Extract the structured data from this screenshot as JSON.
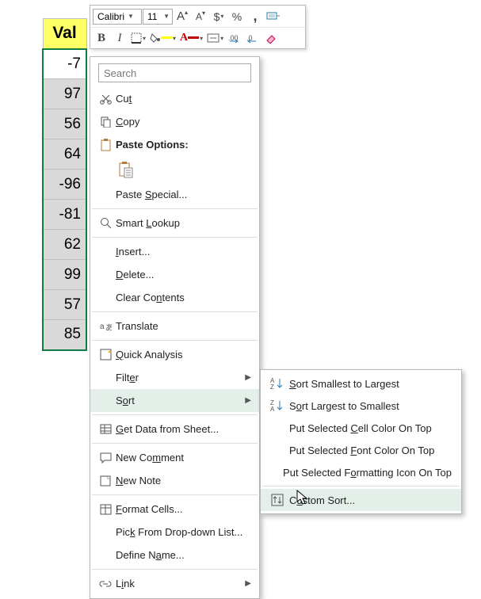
{
  "toolbar": {
    "font": "Calibri",
    "size": "11",
    "increaseFont": "A",
    "decreaseFont": "A",
    "currency": "$",
    "percent": "%",
    "comma": ",",
    "bold": "B",
    "italic": "I"
  },
  "sheet": {
    "header": "Val",
    "values": [
      "-7",
      "97",
      "56",
      "64",
      "-96",
      "-81",
      "62",
      "99",
      "57",
      "85"
    ]
  },
  "search": {
    "placeholder": "Search"
  },
  "ctx": {
    "cut": "Cut",
    "copy": "Copy",
    "pasteOptions": "Paste Options:",
    "pasteSpecial": "Paste Special...",
    "smartLookup": "Smart Lookup",
    "insert": "Insert...",
    "delete": "Delete...",
    "clear": "Clear Contents",
    "translate": "Translate",
    "quick": "Quick Analysis",
    "filter": "Filter",
    "sort": "Sort",
    "getData": "Get Data from Sheet...",
    "newComment": "New Comment",
    "newNote": "New Note",
    "formatCells": "Format Cells...",
    "pickList": "Pick From Drop-down List...",
    "defineName": "Define Name...",
    "link": "Link"
  },
  "sub": {
    "smallest": "Sort Smallest to Largest",
    "largest": "Sort Largest to Smallest",
    "cellColor": "Put Selected Cell Color On Top",
    "fontColor": "Put Selected Font Color On Top",
    "iconTop": "Put Selected Formatting Icon On Top",
    "custom": "Custom Sort..."
  }
}
